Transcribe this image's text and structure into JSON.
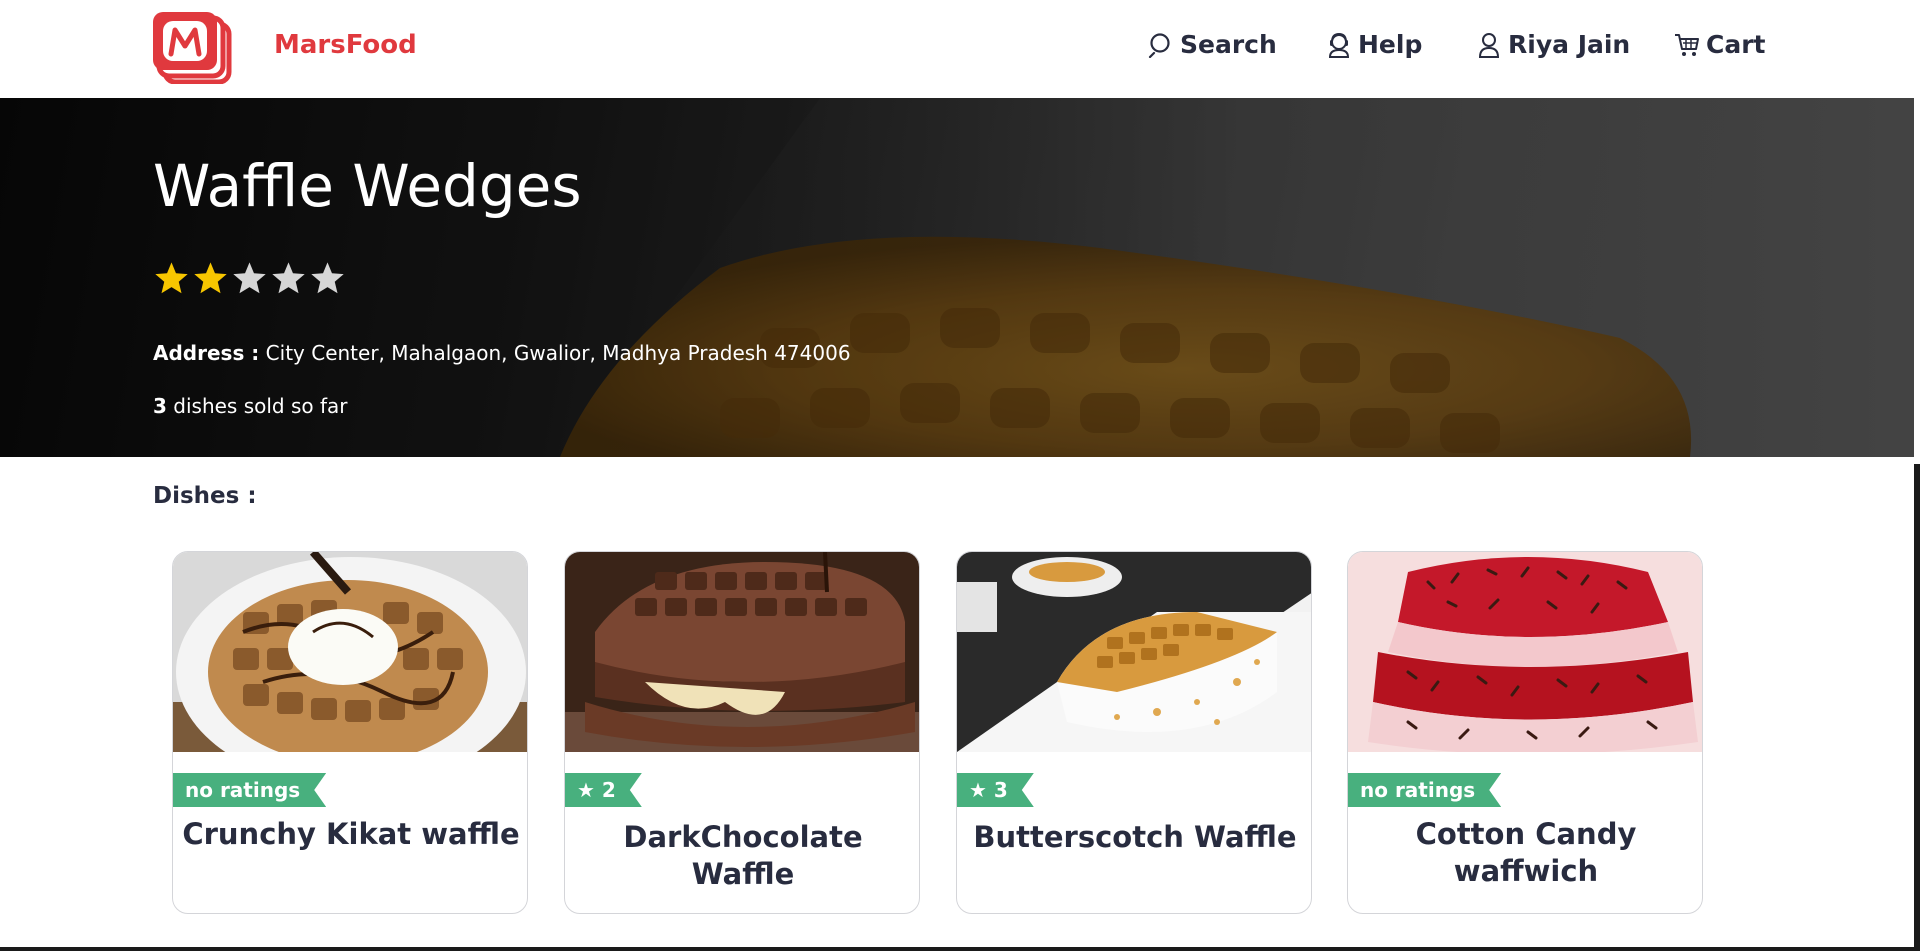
{
  "header": {
    "brand": "MarsFood",
    "nav": {
      "search": "Search",
      "help": "Help",
      "user": "Riya Jain",
      "cart": "Cart"
    }
  },
  "restaurant": {
    "name": "Waffle Wedges",
    "rating": 2,
    "rating_max": 5,
    "address_label": "Address :",
    "address": "City Center, Mahalgaon, Gwalior, Madhya Pradesh 474006",
    "sold_count": "3",
    "sold_text": "dishes sold so far"
  },
  "dishes_label": "Dishes :",
  "dishes": [
    {
      "name": "Crunchy Kikat waffle",
      "badge": "no ratings",
      "image": "waffle-whipped-cream-image"
    },
    {
      "name": "DarkChocolate Waffle",
      "badge": "★ 2",
      "image": "chocolate-waffle-sandwich-image"
    },
    {
      "name": "Butterscotch Waffle",
      "badge": "★ 3",
      "image": "butterscotch-waffle-slice-image"
    },
    {
      "name": "Cotton Candy waffwich",
      "badge": "no ratings",
      "image": "red-velvet-waffle-image"
    }
  ],
  "colors": {
    "brand": "#e0393e",
    "star_filled": "#f7c600",
    "star_empty": "#d6d6d6",
    "badge": "#48b07e",
    "text": "#282c3f"
  }
}
